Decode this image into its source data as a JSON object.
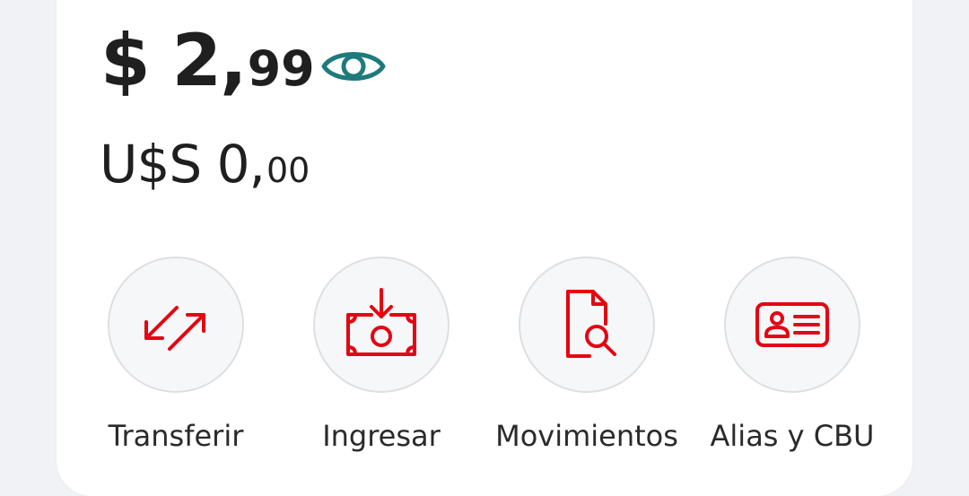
{
  "balances": {
    "ars": {
      "main": "$ 2,",
      "cents": "99"
    },
    "usd": {
      "main": "U$S 0,",
      "cents": "00"
    }
  },
  "visibility": {
    "icon": "eye-icon"
  },
  "actions": [
    {
      "label": "Transferir",
      "icon": "transfer-arrows-icon"
    },
    {
      "label": "Ingresar",
      "icon": "deposit-money-icon"
    },
    {
      "label": "Movimientos",
      "icon": "document-search-icon"
    },
    {
      "label": "Alias y CBU",
      "icon": "id-card-icon"
    }
  ],
  "colors": {
    "accent_red": "#e30613",
    "eye_teal": "#1f7a7c",
    "text": "#1f1f1f",
    "background": "#f1f2f6"
  }
}
